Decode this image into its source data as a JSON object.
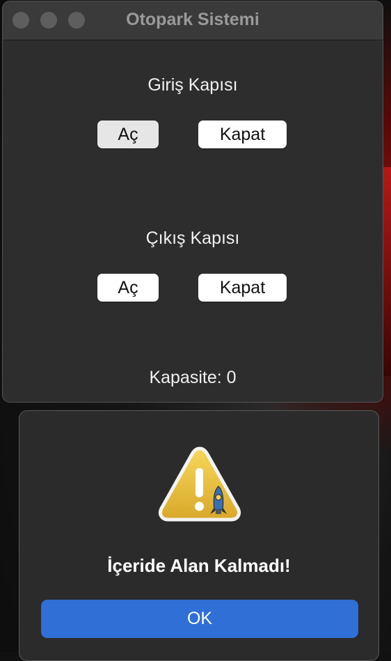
{
  "window": {
    "title": "Otopark Sistemi"
  },
  "entry_gate": {
    "title": "Giriş Kapısı",
    "open_label": "Aç",
    "close_label": "Kapat"
  },
  "exit_gate": {
    "title": "Çıkış Kapısı",
    "open_label": "Aç",
    "close_label": "Kapat"
  },
  "capacity": {
    "text": "Kapasite: 0"
  },
  "alert": {
    "message": "İçeride Alan Kalmadı!",
    "ok_label": "OK",
    "icon": "warning-icon"
  },
  "colors": {
    "window_bg": "#2d2d2d",
    "titlebar_bg": "#3a3a3a",
    "ok_button": "#2f6fd6",
    "warning_yellow": "#e9c23a"
  }
}
